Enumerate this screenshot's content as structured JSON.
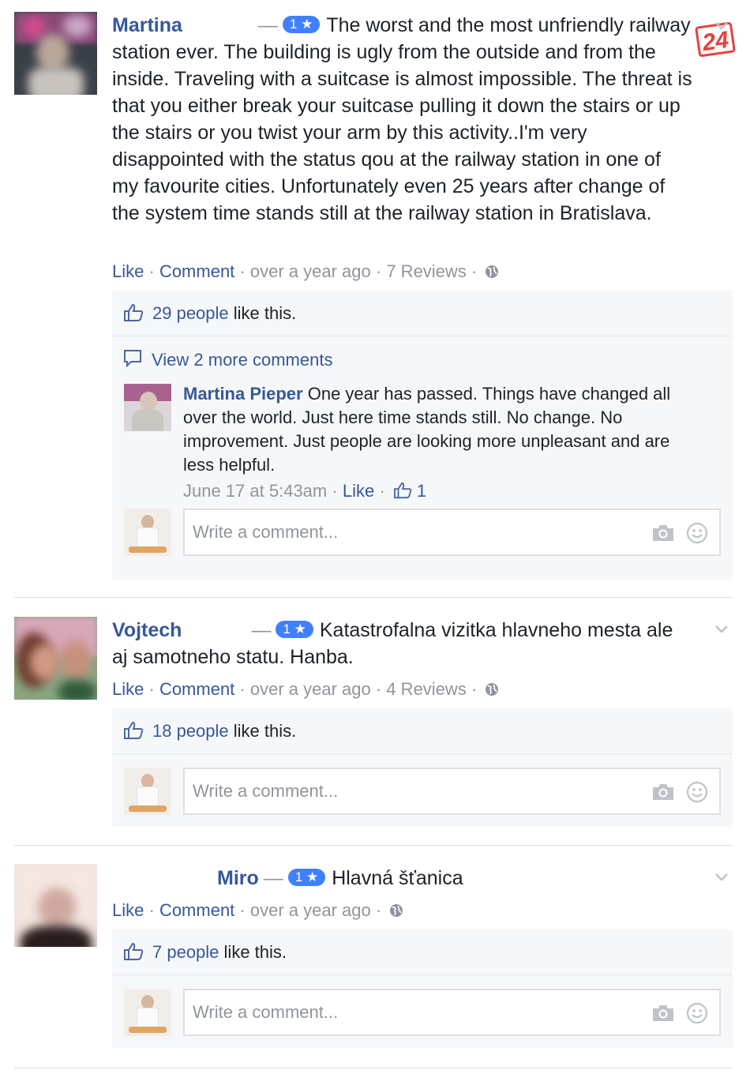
{
  "reviews": [
    {
      "name": "Martina",
      "rating_badge": "1 ★",
      "text": "The worst and the most unfriendly railway station ever. The building is ugly from the outside and from the inside. Traveling with a suitcase is almost impossible. The threat is that you either break your suitcase pulling it down the stairs or up the stairs or you twist your arm by this activity..I'm very disappointed with the status qou at the railway station in one of my favourite cities. Unfortunately even 25 years after change of the system time stands still at the railway station in Bratislava.",
      "like_label": "Like",
      "comment_label": "Comment",
      "time": "over a year ago",
      "reviews_count": "7 Reviews",
      "likes_count": "29 people",
      "likes_suffix": "like this.",
      "view_more": "View 2 more comments",
      "reply": {
        "name": "Martina Pieper",
        "text": "One year has passed. Things have changed all over the world. Just here time stands still. No change. No improvement. Just people are looking more unpleasant and are less helpful.",
        "time": "June 17 at 5:43am",
        "like_label": "Like",
        "like_count": "1"
      },
      "write_placeholder": "Write a comment..."
    },
    {
      "name": "Vojtech",
      "rating_badge": "1 ★",
      "text": "Katastrofalna vizitka hlavneho mesta ale aj samotneho statu. Hanba.",
      "like_label": "Like",
      "comment_label": "Comment",
      "time": "over a year ago",
      "reviews_count": "4 Reviews",
      "likes_count": "18 people",
      "likes_suffix": "like this.",
      "write_placeholder": "Write a comment..."
    },
    {
      "name": "Miro",
      "rating_badge": "1 ★",
      "text": "Hlavná šťanica",
      "like_label": "Like",
      "comment_label": "Comment",
      "time": "over a year ago",
      "likes_count": "7 people",
      "likes_suffix": "like this.",
      "write_placeholder": "Write a comment..."
    }
  ],
  "separator": "·",
  "logo": "24",
  "colors": {
    "link": "#365899",
    "meta": "#90949c",
    "badge": "#4080ff",
    "ufi_bg": "#f6f7f9",
    "logo": "#e8413c"
  },
  "icons": {
    "like": "thumbs-up-icon",
    "comment": "speech-bubble-icon",
    "globe": "globe-icon",
    "camera": "camera-icon",
    "emoji": "smiley-icon",
    "chevron": "chevron-down-icon"
  }
}
